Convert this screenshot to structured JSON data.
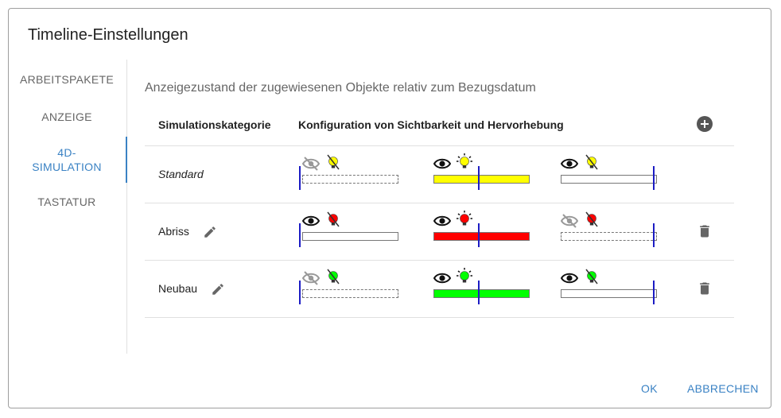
{
  "dialog": {
    "title": "Timeline-Einstellungen",
    "ok_label": "OK",
    "cancel_label": "ABBRECHEN"
  },
  "nav": {
    "items": [
      {
        "label": "ARBEITSPAKETE"
      },
      {
        "label": "ANZEIGE"
      },
      {
        "label": "4D-\nSIMULATION",
        "active": true
      },
      {
        "label": "TASTATUR"
      }
    ]
  },
  "content": {
    "subtitle": "Anzeigezustand der zugewiesenen Objekte relativ zum Bezugsdatum",
    "col_category": "Simulationskategorie",
    "col_config": "Konfiguration von Sichtbarkeit und Hervorhebung",
    "rows": [
      {
        "name": "Standard",
        "color": "#ffff00",
        "cells": [
          {
            "visible": false,
            "highlight": false,
            "filled": false
          },
          {
            "visible": true,
            "highlight": true,
            "filled": true
          },
          {
            "visible": true,
            "highlight": false,
            "filled": false
          }
        ]
      },
      {
        "name": "Abriss",
        "color": "#ff0000",
        "cells": [
          {
            "visible": true,
            "highlight": false,
            "filled": false
          },
          {
            "visible": true,
            "highlight": true,
            "filled": true
          },
          {
            "visible": false,
            "highlight": false,
            "filled": false
          }
        ]
      },
      {
        "name": "Neubau",
        "color": "#00ff00",
        "cells": [
          {
            "visible": false,
            "highlight": false,
            "filled": false
          },
          {
            "visible": true,
            "highlight": true,
            "filled": true
          },
          {
            "visible": true,
            "highlight": false,
            "filled": false
          }
        ]
      }
    ]
  }
}
